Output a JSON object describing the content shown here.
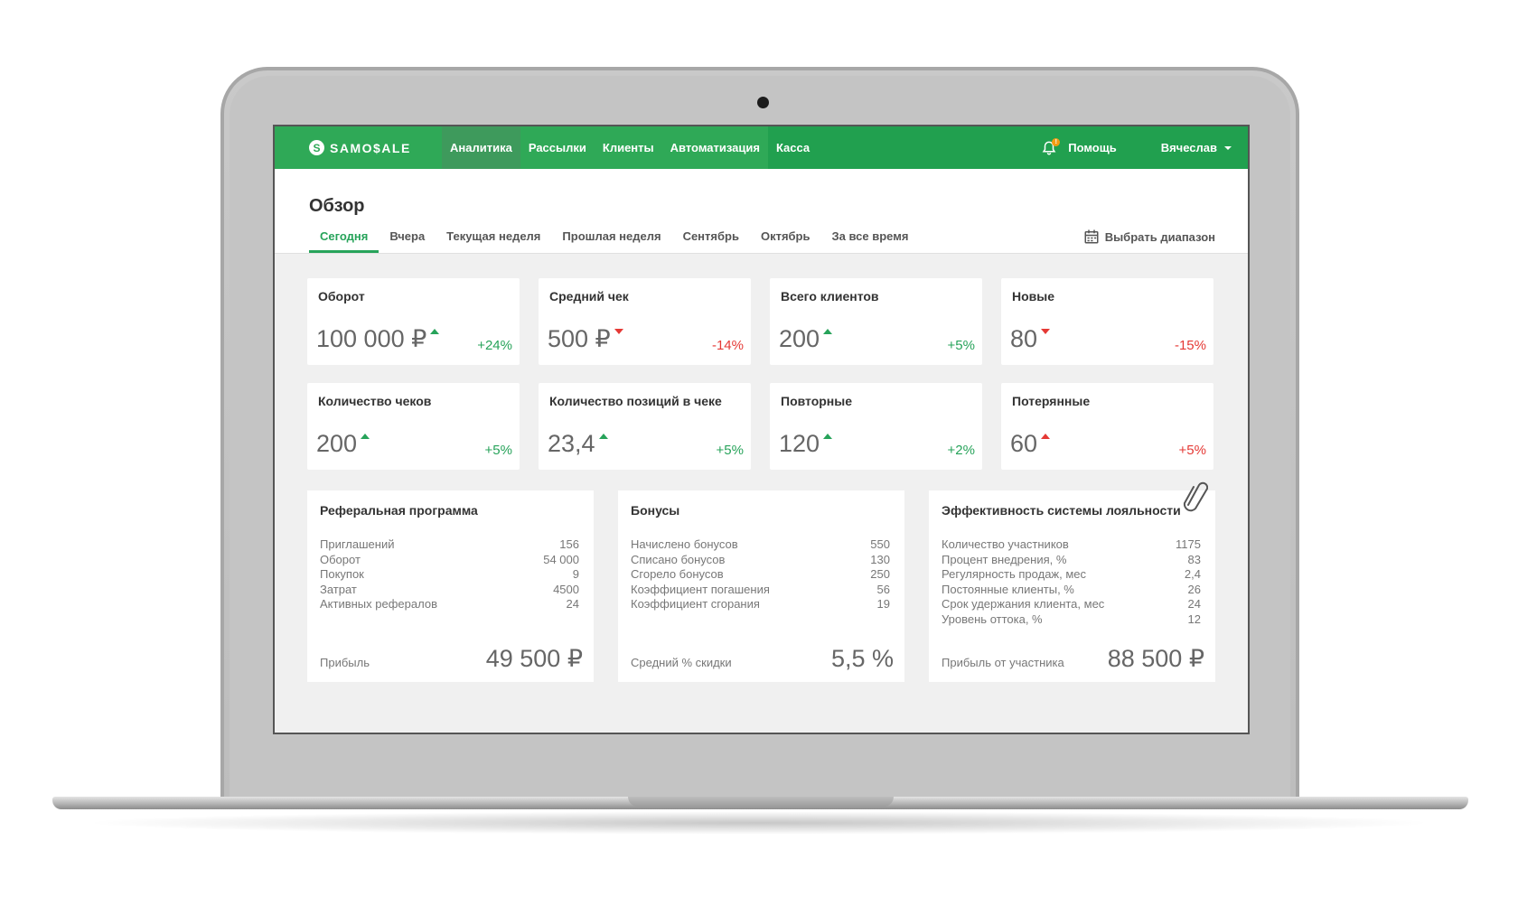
{
  "brand": {
    "logo_text": "SAMO$ALE",
    "logo_mark": "S",
    "color": "#21a04f"
  },
  "nav": {
    "items": [
      {
        "label": "Аналитика"
      },
      {
        "label": "Рассылки"
      },
      {
        "label": "Клиенты"
      },
      {
        "label": "Автоматизация"
      },
      {
        "label": "Касса"
      }
    ],
    "notification_badge": "!",
    "help_label": "Помощь",
    "user_name": "Вячеслав"
  },
  "page": {
    "title": "Обзор",
    "tabs": [
      {
        "label": "Сегодня"
      },
      {
        "label": "Вчера"
      },
      {
        "label": "Текущая неделя"
      },
      {
        "label": "Прошлая неделя"
      },
      {
        "label": "Сентябрь"
      },
      {
        "label": "Октябрь"
      },
      {
        "label": "За все время"
      }
    ],
    "range_label": "Выбрать диапазон"
  },
  "kpis": [
    {
      "title": "Оборот",
      "value": "100 000 ₽",
      "change": "+24%"
    },
    {
      "title": "Средний чек",
      "value": "500 ₽",
      "change": "-14%"
    },
    {
      "title": "Всего клиентов",
      "value": "200",
      "change": "+5%"
    },
    {
      "title": "Новые",
      "value": "80",
      "change": "-15%"
    },
    {
      "title": "Количество чеков",
      "value": "200",
      "change": "+5%"
    },
    {
      "title": "Количество позиций в чеке",
      "value": "23,4",
      "change": "+5%"
    },
    {
      "title": "Повторные",
      "value": "120",
      "change": "+2%"
    },
    {
      "title": "Потерянные",
      "value": "60",
      "change": "+5%"
    }
  ],
  "panels": [
    {
      "title": "Реферальная программа",
      "rows": [
        {
          "label": "Приглашений",
          "value": "156"
        },
        {
          "label": "Оборот",
          "value": "54 000"
        },
        {
          "label": "Покупок",
          "value": "9"
        },
        {
          "label": "Затрат",
          "value": "4500"
        },
        {
          "label": "Активных рефералов",
          "value": "24"
        }
      ],
      "foot_label": "Прибыль",
      "foot_value": "49 500 ₽"
    },
    {
      "title": "Бонусы",
      "rows": [
        {
          "label": "Начислено бонусов",
          "value": "550"
        },
        {
          "label": "Списано бонусов",
          "value": "130"
        },
        {
          "label": "Сгорело бонусов",
          "value": "250"
        },
        {
          "label": "Коэффициент погашения",
          "value": "56"
        },
        {
          "label": "Коэффициент сгорания",
          "value": "19"
        }
      ],
      "foot_label": "Средний % скидки",
      "foot_value": "5,5 %"
    },
    {
      "title": "Эффективность системы лояльности",
      "rows": [
        {
          "label": "Количество участников",
          "value": "1175"
        },
        {
          "label": "Процент внедрения, %",
          "value": "83"
        },
        {
          "label": "Регулярность продаж, мес",
          "value": "2,4"
        },
        {
          "label": "Постоянные клиенты, %",
          "value": "26"
        },
        {
          "label": "Срок удержания клиента, мес",
          "value": "24"
        },
        {
          "label": "Уровень оттока, %",
          "value": "12"
        }
      ],
      "foot_label": "Прибыль от участника",
      "foot_value": "88 500 ₽"
    }
  ]
}
